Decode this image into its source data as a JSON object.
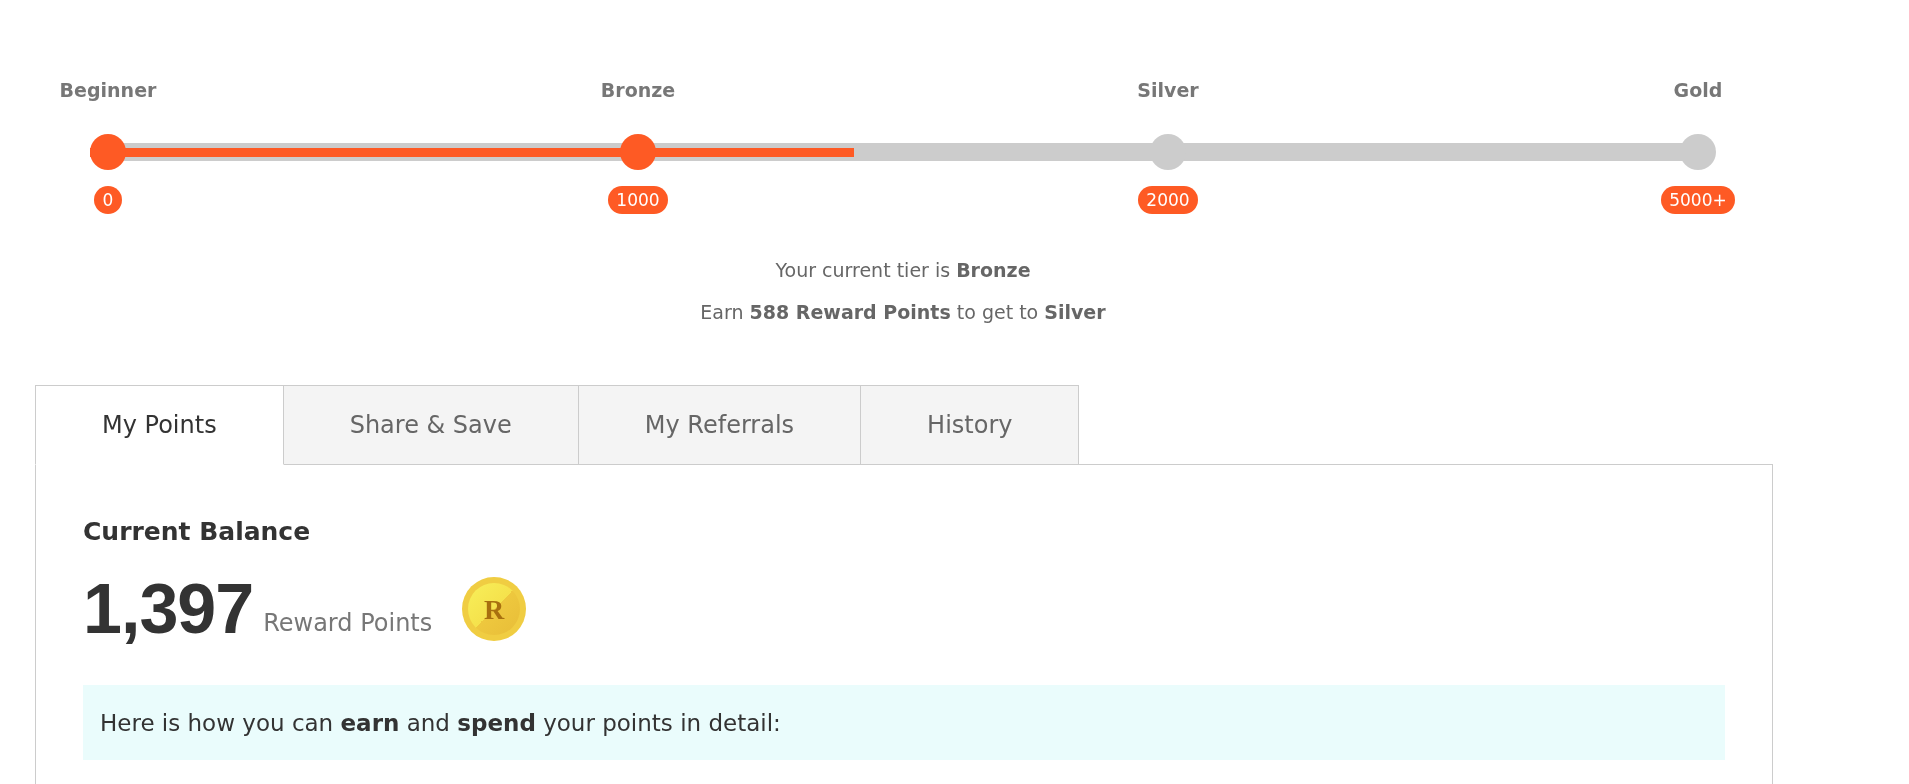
{
  "tier_progress": {
    "level": 0.47,
    "tiers": [
      {
        "name": "Beginner",
        "threshold": "0",
        "reached": true
      },
      {
        "name": "Bronze",
        "threshold": "1000",
        "reached": true
      },
      {
        "name": "Silver",
        "threshold": "2000",
        "reached": false
      },
      {
        "name": "Gold",
        "threshold": "5000+",
        "reached": false
      }
    ]
  },
  "tier_status": [
    "Your current tier is **Bronze**",
    "Earn **588 Reward Points** to get to **Silver**"
  ],
  "tabs": [
    {
      "label": "My Points",
      "selected": true
    },
    {
      "label": "Share & Save",
      "selected": false
    },
    {
      "label": "My Referrals",
      "selected": false
    },
    {
      "label": "History",
      "selected": false
    }
  ],
  "balance": {
    "title": "Current Balance",
    "amount": "1,397",
    "unit": "Reward Points",
    "coin_letter": "R"
  },
  "info_note": "Here is how you can **earn** and **spend** your points in detail:"
}
